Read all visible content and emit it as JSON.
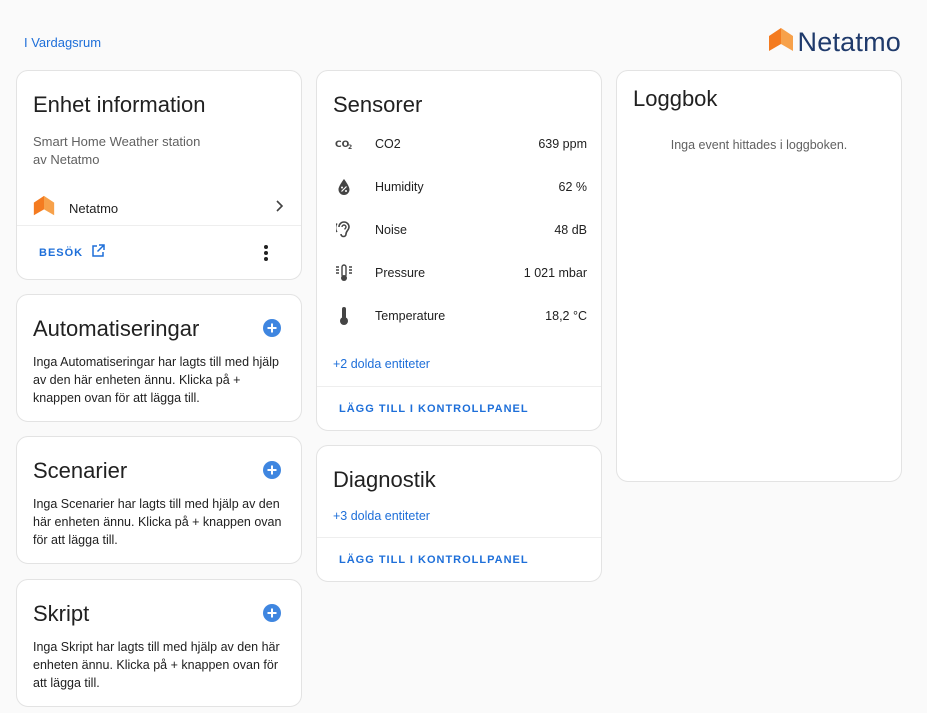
{
  "header": {
    "area_link": "I Vardagsrum",
    "logo_text": "Netatmo",
    "brand_orange": "#f47b20",
    "brand_navy": "#1f3a6b"
  },
  "device_info": {
    "title": "Enhet information",
    "model_line1": "Smart Home Weather station",
    "model_line2": "av Netatmo",
    "integration_name": "Netatmo",
    "visit_label": "BESÖK"
  },
  "automations": {
    "title": "Automatiseringar",
    "description": "Inga Automatiseringar har lagts till med hjälp av den här enheten ännu. Klicka på + knappen ovan för att lägga till."
  },
  "scenes": {
    "title": "Scenarier",
    "description": "Inga Scenarier har lagts till med hjälp av den här enheten ännu. Klicka på + knappen ovan för att lägga till."
  },
  "scripts": {
    "title": "Skript",
    "description": "Inga Skript har lagts till med hjälp av den här enheten ännu. Klicka på + knappen ovan för att lägga till."
  },
  "sensors": {
    "title": "Sensorer",
    "items": [
      {
        "icon": "co2-icon",
        "name": "CO2",
        "value": "639 ppm"
      },
      {
        "icon": "water-percent-icon",
        "name": "Humidity",
        "value": "62 %"
      },
      {
        "icon": "ear-icon",
        "name": "Noise",
        "value": "48 dB"
      },
      {
        "icon": "gauge-icon",
        "name": "Pressure",
        "value": "1 021 mbar"
      },
      {
        "icon": "thermometer-icon",
        "name": "Temperature",
        "value": "18,2 °C"
      }
    ],
    "hidden_entities": "+2 dolda entiteter",
    "add_to_dashboard": "LÄGG TILL I KONTROLLPANEL"
  },
  "diagnostics": {
    "title": "Diagnostik",
    "hidden_entities": "+3 dolda entiteter",
    "add_to_dashboard": "LÄGG TILL I KONTROLLPANEL"
  },
  "logbook": {
    "title": "Loggbok",
    "empty_text": "Inga event hittades i loggboken."
  },
  "colors": {
    "accent": "#1e6fd9",
    "add_button": "#3f86e0"
  }
}
